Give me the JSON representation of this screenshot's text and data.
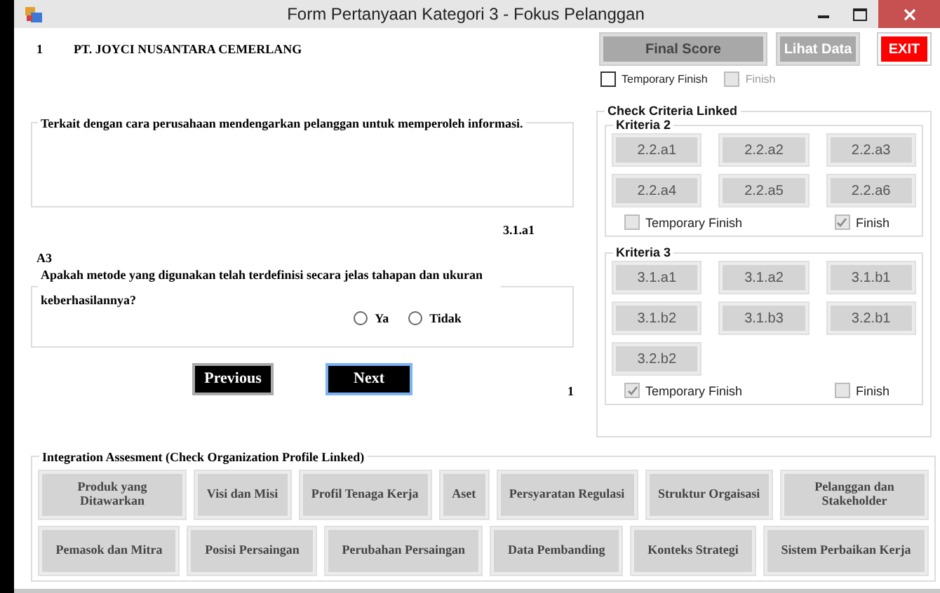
{
  "window": {
    "title": "Form Pertanyaan Kategori 3 - Fokus Pelanggan"
  },
  "header": {
    "number": "1",
    "company": "PT. JOYCI NUSANTARA CEMERLANG",
    "buttons": [
      {
        "label": "Final Score",
        "kind": "score"
      },
      {
        "label": "Lihat Data",
        "kind": "data"
      },
      {
        "label": "EXIT",
        "kind": "exit"
      }
    ],
    "checks": [
      {
        "label": "Temporary Finish",
        "checked": false,
        "disabled": false
      },
      {
        "label": "Finish",
        "checked": false,
        "disabled": true
      }
    ]
  },
  "question_1": {
    "text": "Terkait dengan cara perusahaan mendengarkan pelanggan untuk memperoleh informasi.",
    "code": "3.1.a1"
  },
  "question_2": {
    "label": "A3",
    "text": "Apakah metode yang digunakan telah terdefinisi secara jelas tahapan dan ukuran keberhasilannya?",
    "options": [
      {
        "label": "Ya",
        "selected": false
      },
      {
        "label": "Tidak",
        "selected": false
      }
    ]
  },
  "navigation": {
    "buttons": [
      {
        "label": "Previous",
        "focused": false
      },
      {
        "label": "Next",
        "focused": true
      }
    ],
    "page": "1"
  },
  "criteria": {
    "title": "Check Criteria Linked",
    "groups": [
      {
        "title": "Kriteria 2",
        "items": [
          "2.2.a1",
          "2.2.a2",
          "2.2.a3",
          "2.2.a4",
          "2.2.a5",
          "2.2.a6"
        ],
        "checks": [
          {
            "label": "Temporary Finish",
            "checked": false
          },
          {
            "label": "Finish",
            "checked": true
          }
        ]
      },
      {
        "title": "Kriteria 3",
        "items": [
          "3.1.a1",
          "3.1.a2",
          "3.1.b1",
          "3.1.b2",
          "3.1.b3",
          "3.2.b1",
          "3.2.b2"
        ],
        "checks": [
          {
            "label": "Temporary Finish",
            "checked": true
          },
          {
            "label": "Finish",
            "checked": false
          }
        ]
      }
    ]
  },
  "integration": {
    "title": "Integration Assesment (Check Organization Profile Linked)",
    "button_rows": [
      {
        "buttons": [
          "Produk yang Ditawarkan",
          "Visi dan Misi",
          "Profil Tenaga Kerja",
          "Aset",
          "Persyaratan Regulasi",
          "Struktur Orgaisasi",
          "Pelanggan dan Stakeholder"
        ]
      },
      {
        "buttons": [
          "Pemasok dan Mitra",
          "Posisi Persaingan",
          "Perubahan Persaingan",
          "Data Pembanding",
          "Konteks Strategi",
          "Sistem Perbaikan Kerja"
        ]
      }
    ]
  }
}
